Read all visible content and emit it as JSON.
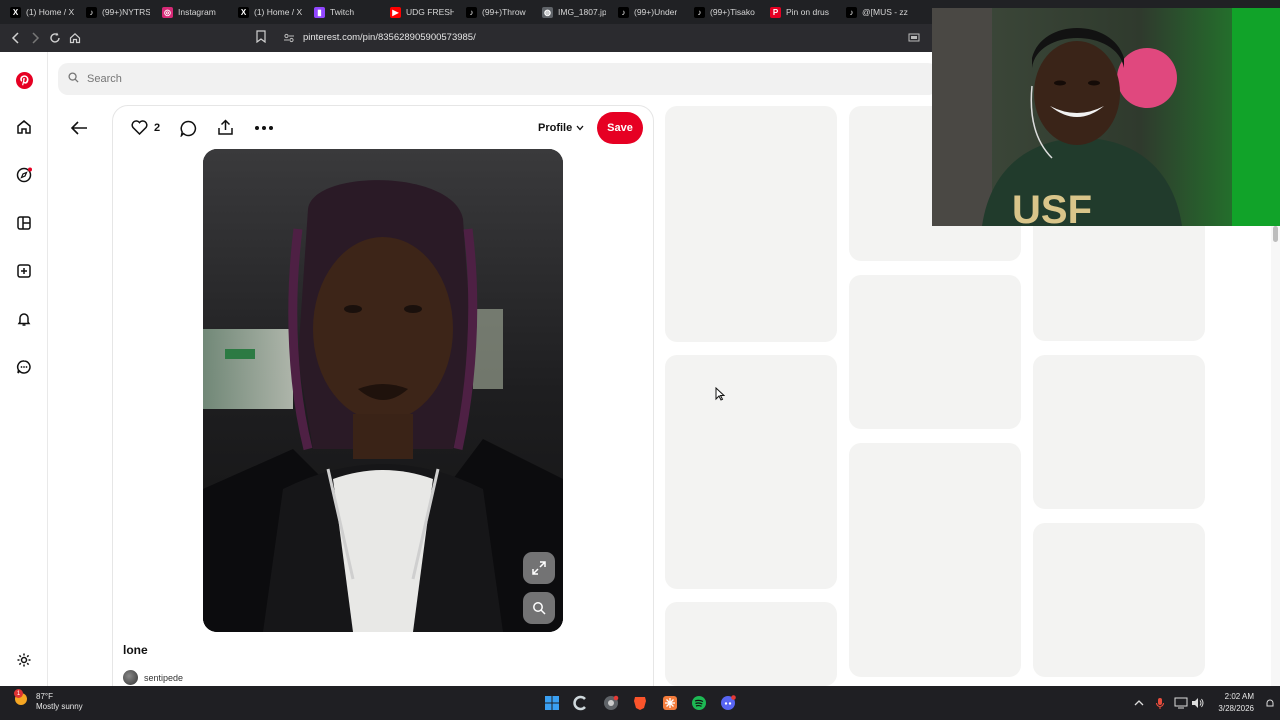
{
  "browser": {
    "tabs": [
      {
        "label": "(1) Home / X",
        "icon": "x-logo-icon",
        "color": "#000000"
      },
      {
        "label": "(99+)NYTRS",
        "icon": "tiktok-icon",
        "color": "#000000"
      },
      {
        "label": "Instagram",
        "icon": "instagram-icon",
        "color": "#d62976"
      },
      {
        "label": "(1) Home / X",
        "icon": "x-logo-icon",
        "color": "#000000"
      },
      {
        "label": "Twitch",
        "icon": "twitch-icon",
        "color": "#9146ff"
      },
      {
        "label": "UDG FRESH",
        "icon": "youtube-icon",
        "color": "#ff0000"
      },
      {
        "label": "(99+)Throw",
        "icon": "tiktok-icon",
        "color": "#000000"
      },
      {
        "label": "IMG_1807.jp",
        "icon": "globe-icon",
        "color": "#5f6368"
      },
      {
        "label": "(99+)Under",
        "icon": "tiktok-icon",
        "color": "#000000"
      },
      {
        "label": "(99+)Tisako",
        "icon": "tiktok-icon",
        "color": "#000000"
      },
      {
        "label": "Pin on drus",
        "icon": "pinterest-icon",
        "color": "#e60023"
      },
      {
        "label": "@[MUS - zz",
        "icon": "tiktok-icon",
        "color": "#000000"
      }
    ],
    "url": "pinterest.com/pin/835628905900573985/"
  },
  "search": {
    "placeholder": "Search"
  },
  "pin": {
    "like_count": "2",
    "profile_label": "Profile",
    "save_label": "Save",
    "title": "lone",
    "author": "sentipede"
  },
  "taskbar": {
    "weather_temp": "87°F",
    "weather_desc": "Mostly sunny",
    "weather_badge": "1",
    "time": "2:02 AM",
    "date": "3/28/2026"
  },
  "colors": {
    "pinterest_red": "#e60023",
    "skeleton": "#f3f3f2"
  }
}
